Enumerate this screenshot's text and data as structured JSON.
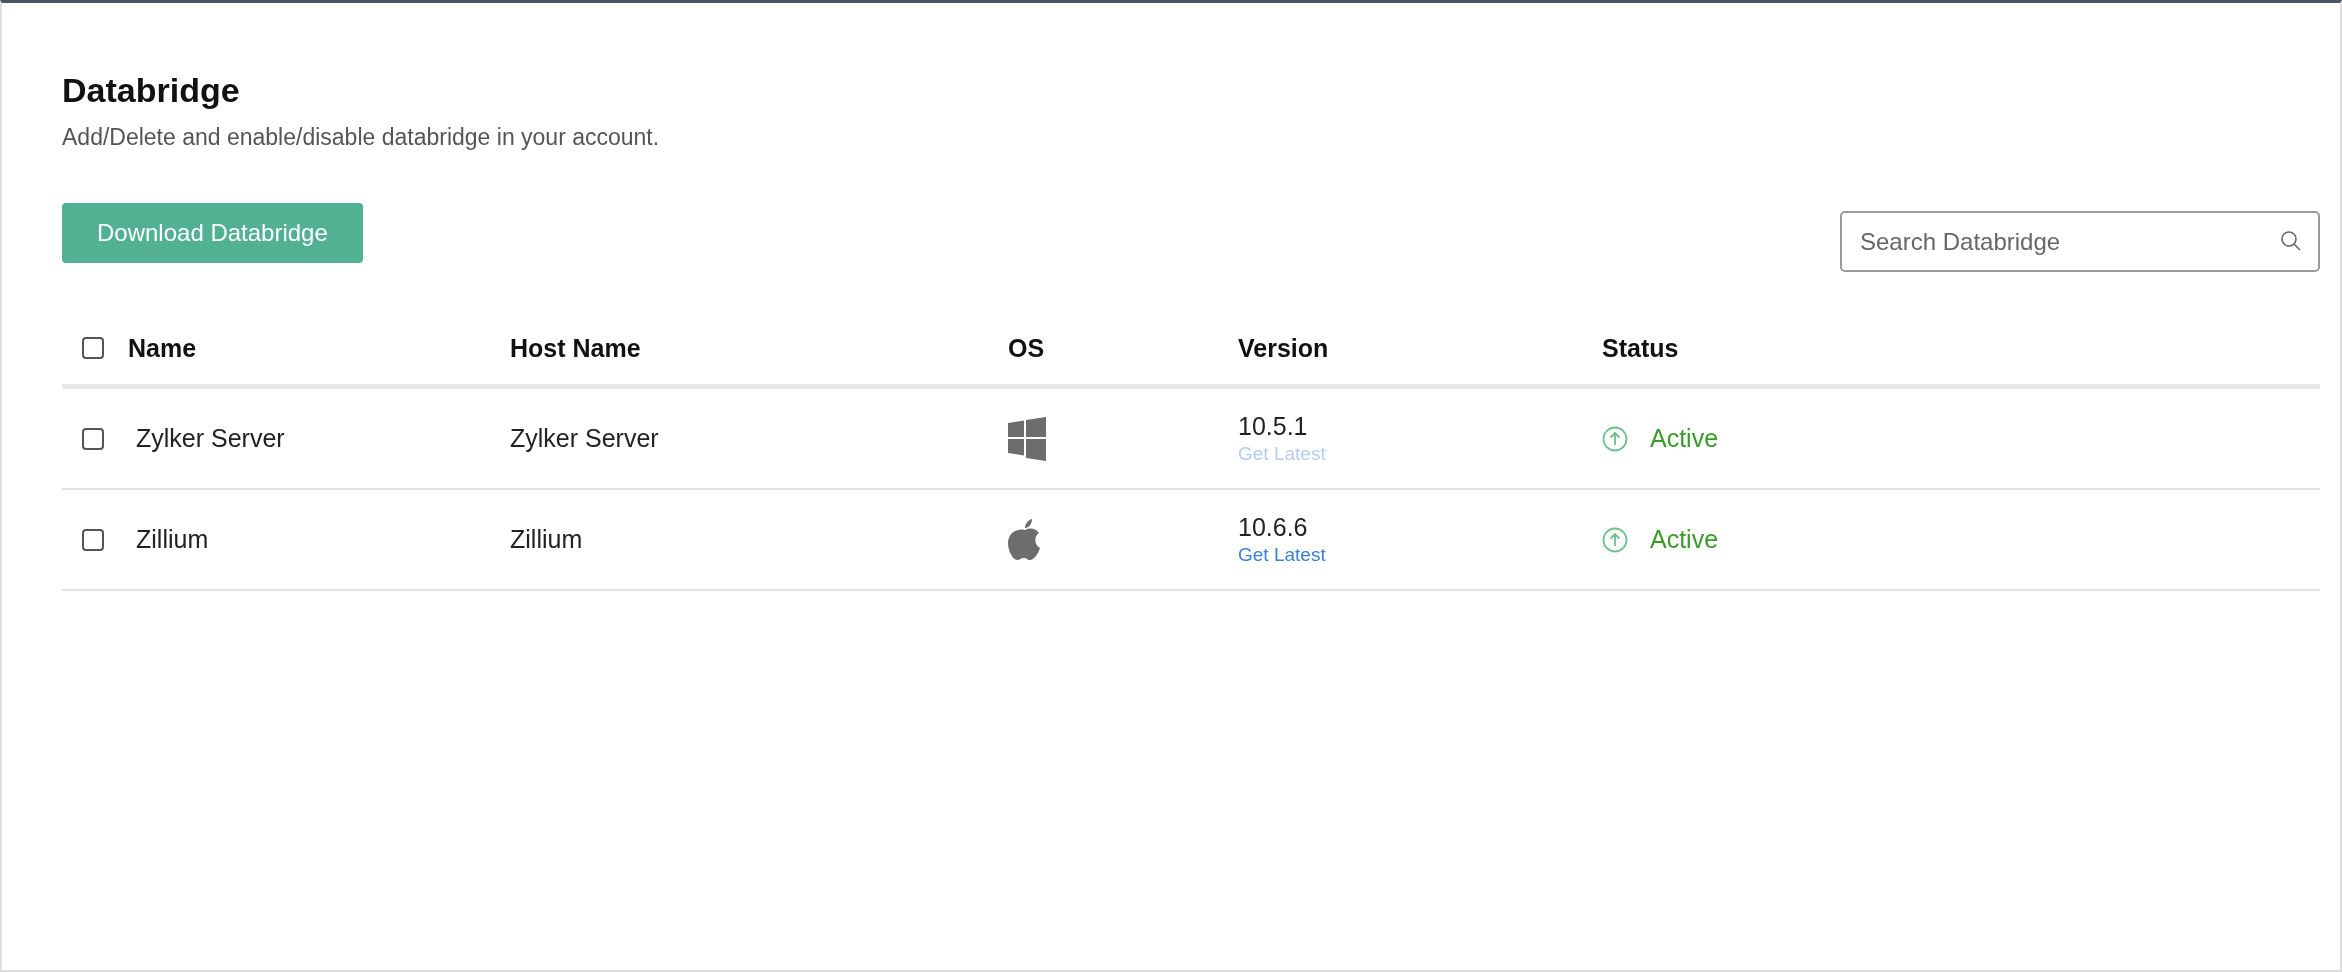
{
  "page": {
    "title": "Databridge",
    "subtitle": "Add/Delete and enable/disable databridge in your account."
  },
  "download_button": "Download Databridge",
  "search": {
    "placeholder": "Search Databridge"
  },
  "table": {
    "select_all_checked": false,
    "columns": [
      "Name",
      "Host Name",
      "OS",
      "Version",
      "Status"
    ],
    "rows": [
      {
        "checked": false,
        "name": "Zylker Server",
        "host_name": "Zylker Server",
        "os": {
          "kind": "windows"
        },
        "version": "10.5.1",
        "update_link": {
          "label": "Get Latest",
          "disabled": true
        },
        "status": {
          "kind": "active",
          "label": "Active"
        }
      },
      {
        "checked": false,
        "name": "Zillium",
        "host_name": "Zillium",
        "os": {
          "kind": "apple"
        },
        "version": "10.6.6",
        "update_link": {
          "label": "Get Latest",
          "disabled": false
        },
        "status": {
          "kind": "active",
          "label": "Active"
        }
      }
    ]
  }
}
